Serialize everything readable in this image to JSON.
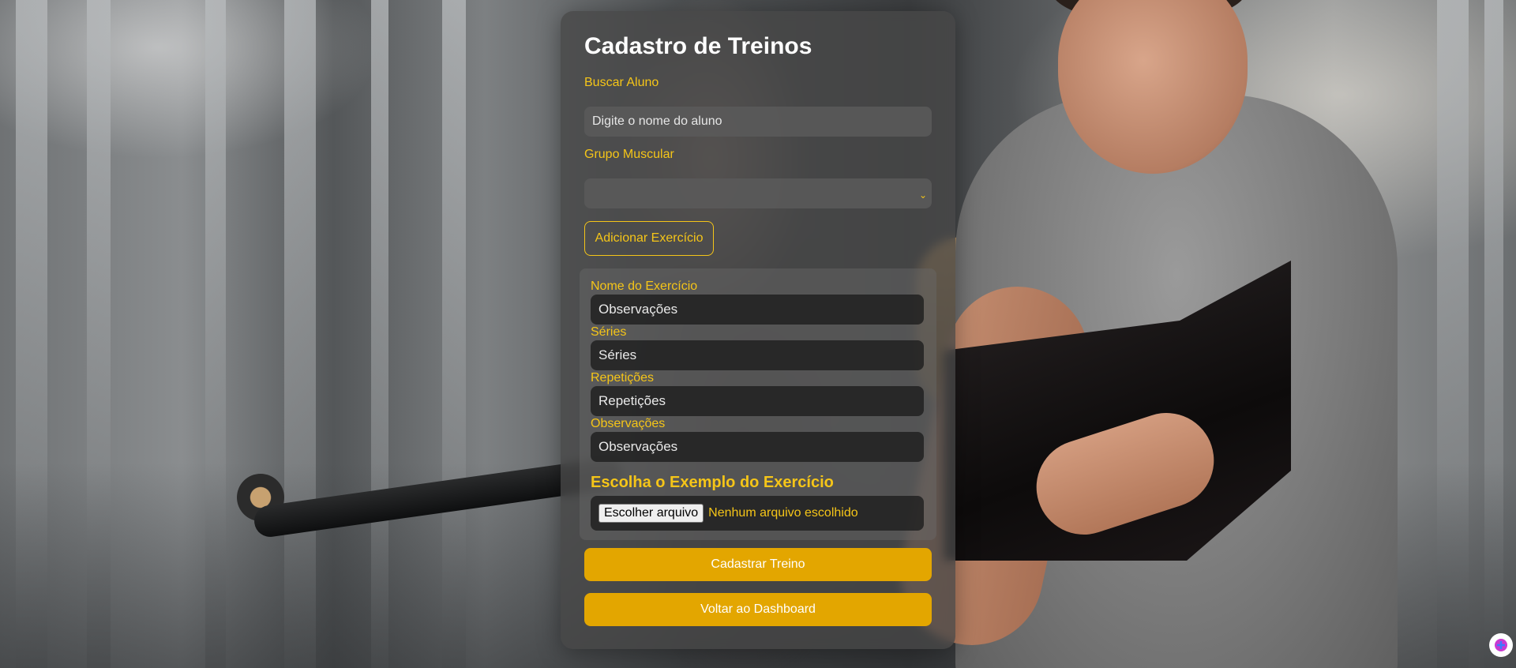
{
  "page": {
    "title": "Cadastro de Treinos"
  },
  "form": {
    "student_label": "Buscar Aluno",
    "student_placeholder": "Digite o nome do aluno",
    "muscle_group_label": "Grupo Muscular",
    "muscle_group_value": "",
    "add_exercise_label": "Adicionar Exercício"
  },
  "exercise": {
    "name_label": "Nome do Exercício",
    "name_placeholder": "Observações",
    "sets_label": "Séries",
    "sets_placeholder": "Séries",
    "reps_label": "Repetições",
    "reps_placeholder": "Repetições",
    "notes_label": "Observações",
    "notes_placeholder": "Observações",
    "example_heading": "Escolha o Exemplo do Exercício",
    "file_button_label": "Escolher arquivo",
    "file_status": "Nenhum arquivo escolhido"
  },
  "actions": {
    "submit_label": "Cadastrar Treino",
    "back_label": "Voltar ao Dashboard"
  },
  "colors": {
    "accent": "#f5c518",
    "button": "#e3a600",
    "panel": "#464646"
  },
  "icons": {
    "select_chevron": "chevron-down-icon",
    "corner_extension": "extension-icon"
  }
}
